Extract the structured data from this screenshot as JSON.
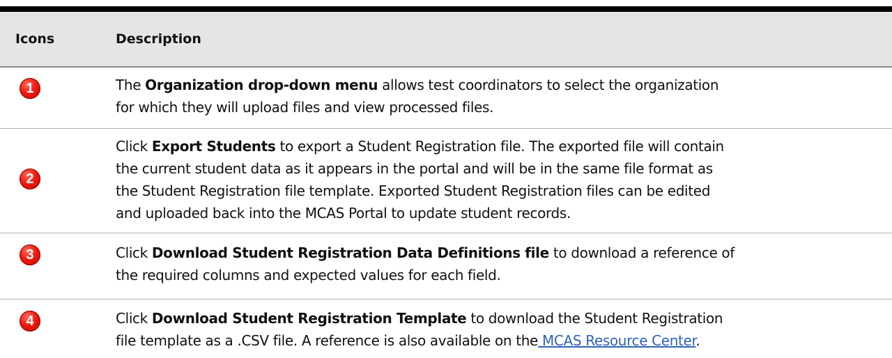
{
  "table": {
    "headers": {
      "icons": "Icons",
      "description": "Description"
    },
    "rows": [
      {
        "icon_number": "1",
        "lines": [
          {
            "before": "The ",
            "bold": "Organization drop-down menu",
            "after": " allows test coordinators to select the organization"
          },
          {
            "text": "for which they will upload files and view processed files."
          }
        ]
      },
      {
        "icon_number": "2",
        "lines": [
          {
            "before": "Click ",
            "bold": "Export Students",
            "after": " to export a Student Registration file. The exported file will contain"
          },
          {
            "text": "the current student data as it appears in the portal and will be in the same file format as"
          },
          {
            "text": "the Student Registration file template. Exported Student Registration files can be edited"
          },
          {
            "text": "and uploaded back into the MCAS Portal to update student records."
          }
        ]
      },
      {
        "icon_number": "3",
        "lines": [
          {
            "before": "Click ",
            "bold": "Download Student Registration Data Definitions file",
            "after": " to download a reference of"
          },
          {
            "text": "the required columns and expected values for each field."
          }
        ]
      },
      {
        "icon_number": "4",
        "lines": [
          {
            "before": "Click ",
            "bold": "Download Student Registration Template",
            "after": " to download the Student Registration"
          },
          {
            "text_before_link": "file template as a .CSV file. A reference is also available on the",
            "link": " MCAS Resource Center",
            "text_after_link": "."
          }
        ]
      }
    ]
  },
  "colors": {
    "header_background": "#e5e5e5",
    "icon_red": "#f0190d",
    "link_blue": "#2e62b8"
  }
}
